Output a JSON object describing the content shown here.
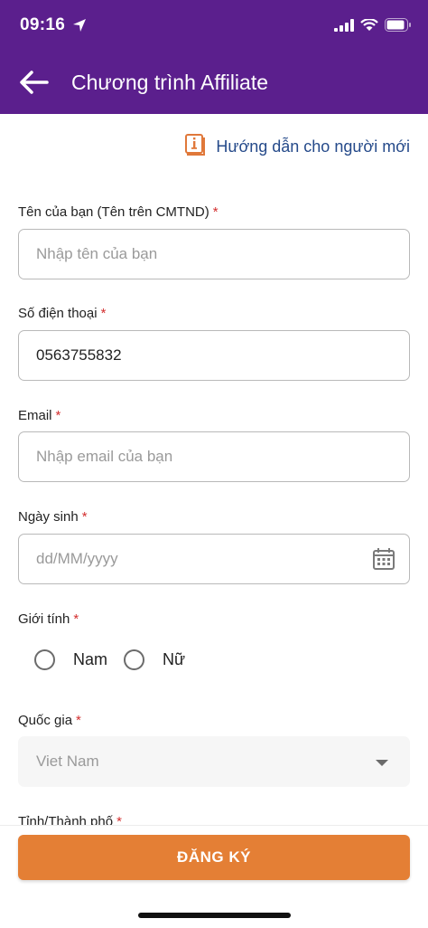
{
  "status_bar": {
    "time": "09:16",
    "icons": [
      "location-arrow-icon",
      "cellular-signal-icon",
      "wifi-icon",
      "battery-icon"
    ]
  },
  "header": {
    "back_icon": "arrow-left-icon",
    "title": "Chương trình Affiliate",
    "background": "#5b1f8d"
  },
  "guide": {
    "icon": "info-book-icon",
    "label": "Hướng dẫn cho người mới"
  },
  "form": {
    "name": {
      "label": "Tên của bạn (Tên trên CMTND)",
      "required_mark": "*",
      "placeholder": "Nhập tên của bạn",
      "value": ""
    },
    "phone": {
      "label": "Số điện thoại",
      "required_mark": "*",
      "placeholder": "",
      "value": "0563755832"
    },
    "email": {
      "label": "Email",
      "required_mark": "*",
      "placeholder": "Nhập email của bạn",
      "value": ""
    },
    "birthday": {
      "label": "Ngày sinh",
      "required_mark": "*",
      "placeholder": "dd/MM/yyyy",
      "value": "",
      "icon": "calendar-icon"
    },
    "gender": {
      "label": "Giới tính",
      "required_mark": "*",
      "options": [
        "Nam",
        "Nữ"
      ],
      "selected": null
    },
    "country": {
      "label": "Quốc gia",
      "required_mark": "*",
      "value": "Viet Nam",
      "icon": "caret-down-icon"
    },
    "province": {
      "label": "Tỉnh/Thành phố",
      "required_mark": "*"
    }
  },
  "actions": {
    "register_label": "ĐĂNG KÝ",
    "register_color": "#e47f35"
  },
  "colors": {
    "required": "#d32f2f",
    "link": "#254a8a",
    "guide_icon": "#e0783a"
  }
}
